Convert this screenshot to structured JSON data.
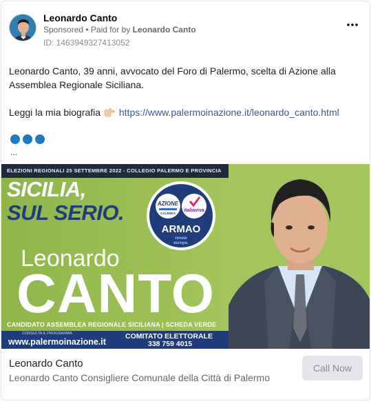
{
  "post": {
    "page_name": "Leonardo Canto",
    "sponsored": "Sponsored",
    "paid_prefix": "• Paid for by",
    "payer": "Leonardo Canto",
    "ad_id": "ID: 1463949327413052",
    "more_icon": "ellipsis-icon"
  },
  "body": {
    "line1": "Leonardo Canto, 39 anni, avvocato del Foro di Palermo, scelta di Azione alla Assemblea Regionale Siciliana.",
    "bio_prefix": "Leggi la mia biografia",
    "bio_link": "https://www.palermoinazione.it/leonardo_canto.html",
    "ellipsis": "...",
    "colors": {
      "dots": "#1f7bc0",
      "link": "#385898"
    }
  },
  "ad_image": {
    "top_bar": "ELEZIONI REGIONALI 25 SETTEMBRE 2022 - COLLEGIO PALERMO E PROVINCIA",
    "slogan_line1": "SICILIA,",
    "slogan_line2": "SUL SERIO.",
    "first_name": "Leonardo",
    "last_name": "CANTO",
    "subtitle": "CANDIDATO ASSEMBLEA REGIONALE SICILIANA  |  SCHEDA VERDE",
    "consulta": "CONSULTA IL PROGRAMMA",
    "website": "www.palermoinazione.it",
    "comitato": "COMITATO ELETTORALE",
    "phone": "338 759 4015",
    "logo": {
      "azione": "AZIONE",
      "calenda": "CALENDA",
      "italiaviva": "italiaviva",
      "armao": "ARMAO",
      "renew": "renew",
      "europe": "europe."
    },
    "colors": {
      "green": "#9cc055",
      "navy": "#1f3c7b"
    }
  },
  "footer": {
    "title": "Leonardo Canto",
    "description": "Leonardo Canto Consigliere Comunale della Città di Palermo",
    "cta": "Call Now"
  }
}
